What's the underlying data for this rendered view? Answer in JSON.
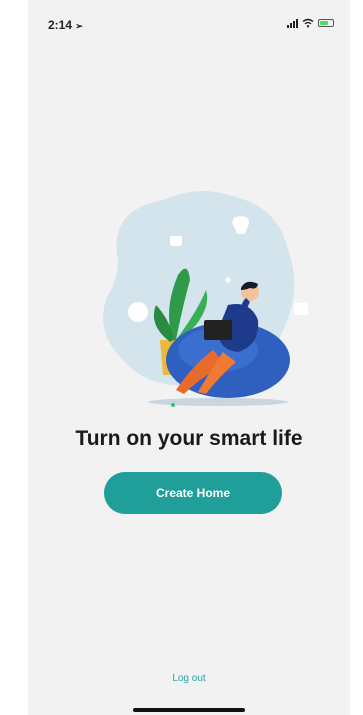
{
  "status_bar": {
    "time": "2:14",
    "location_icon": "location-arrow-icon",
    "signal_icon": "cellular-signal-icon",
    "wifi_icon": "wifi-icon",
    "battery_icon": "battery-icon"
  },
  "illustration": {
    "icon": "person-on-beanbag-illustration"
  },
  "main": {
    "headline": "Turn on your smart life",
    "create_button_label": "Create Home",
    "logout_label": "Log out"
  },
  "colors": {
    "accent": "#1f9e9a",
    "link": "#2aa3b0",
    "background": "#f2f2f2"
  }
}
